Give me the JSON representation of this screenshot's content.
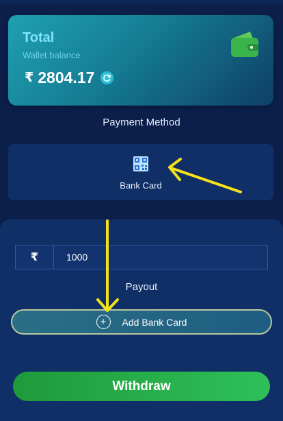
{
  "wallet": {
    "title": "Total",
    "subtitle": "Wallet balance",
    "currency_symbol": "₹",
    "balance": "2804.17"
  },
  "payment": {
    "section_label": "Payment Method",
    "method_label": "Bank Card",
    "method_icon": "qr-code-icon"
  },
  "form": {
    "currency_symbol": "₹",
    "amount_value": "1000",
    "payout_label": "Payout",
    "add_card_label": "Add Bank Card",
    "withdraw_label": "Withdraw"
  },
  "colors": {
    "background": "#0b1f4a",
    "card_accent": "#1fa0b2",
    "withdraw_green": "#2fc05a",
    "annotation_arrow": "#f4e21a"
  },
  "icons": [
    "wallet-icon",
    "refresh-icon",
    "qr-code-icon",
    "plus-circle-icon"
  ]
}
